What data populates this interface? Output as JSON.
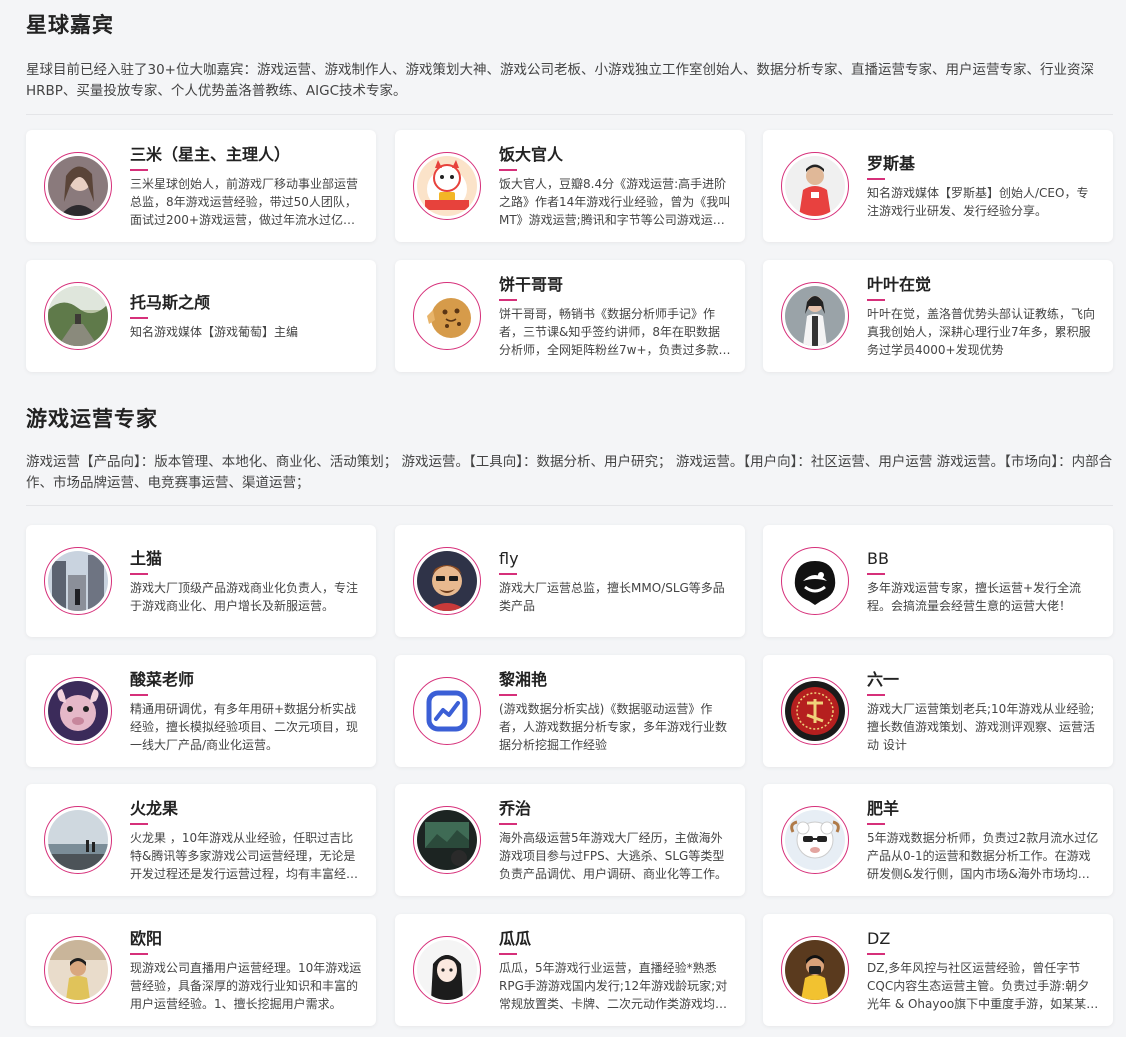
{
  "guests_section": {
    "title": "星球嘉宾",
    "description": "星球目前已经入驻了30+位大咖嘉宾：游戏运营、游戏制作人、游戏策划大神、游戏公司老板、小游戏独立工作室创始人、数据分析专家、直播运营专家、用户运营专家、行业资深HRBP、买量投放专家、个人优势盖洛普教练、AIGC技术专家。",
    "cards": [
      {
        "name": "三米（星主、主理人）",
        "bio": "三米星球创始人，前游戏厂移动事业部运营总监，8年游戏运营经验，带过50人团队，面试过200+游戏运营，做过年流水过亿的游戏项目。",
        "avatar": "portrait-photo"
      },
      {
        "name": "饭大官人",
        "bio": "饭大官人，豆瓣8.4分《游戏运营:高手进阶之路》作者14年游戏行业经验，曾为《我叫 MT》游戏运营;腾讯和字节等公司游戏运营。",
        "avatar": "lucky-cat-icon"
      },
      {
        "name": "罗斯基",
        "bio": "知名游戏媒体【罗斯基】创始人/CEO，专注游戏行业研发、发行经验分享。",
        "avatar": "portrait-photo"
      },
      {
        "name": "托马斯之颅",
        "bio": "知名游戏媒体【游戏葡萄】主编",
        "avatar": "landscape-photo"
      },
      {
        "name": "饼干哥哥",
        "bio": "饼干哥哥，畅销书《数据分析师手记》作者，三节课&知乎签约讲师，8年在职数据分析师，全网矩阵粉丝7w+，负责过多款游戏数据分析。",
        "avatar": "cookie-icon"
      },
      {
        "name": "叶叶在觉",
        "bio": "叶叶在觉，盖洛普优势头部认证教练，飞向真我创始人，深耕心理行业7年多，累积服务过学员4000+发现优势",
        "avatar": "portrait-photo"
      }
    ]
  },
  "experts_section": {
    "title": "游戏运营专家",
    "description": "游戏运营【产品向】：版本管理、本地化、商业化、活动策划； 游戏运营。【工具向】：数据分析、用户研究； 游戏运营。【用户向】：社区运营、用户运营 游戏运营。【市场向】：内部合作、市场品牌运营、电竞赛事运营、渠道运营；",
    "cards": [
      {
        "name": "土猫",
        "bio": "游戏大厂顶级产品游戏商业化负责人，专注于游戏商业化、用户增长及新服运营。",
        "avatar": "city-photo"
      },
      {
        "name": "fly",
        "bio": "游戏大厂运营总监，擅长MMO/SLG等多品类产品",
        "avatar": "cartoon-avatar"
      },
      {
        "name": "BB",
        "bio": "多年游戏运营专家，擅长运营+发行全流程。会搞流量会经营生意的运营大佬！",
        "avatar": "bird-logo-icon"
      },
      {
        "name": "酸菜老师",
        "bio": "精通用研调优，有多年用研+数据分析实战经验，擅长模拟经验项目、二次元项目，现一线大厂产品/商业化运营。",
        "avatar": "creature-photo"
      },
      {
        "name": "黎湘艳",
        "bio": "(游戏数据分析实战)《数据驱动运营》作者，人游戏数据分析专家，多年游戏行业数据分析挖掘工作经验",
        "avatar": "chart-logo-icon"
      },
      {
        "name": "六一",
        "bio": "游戏大厂运营策划老兵;10年游戏从业经验;擅长数值游戏策划、游戏测评观察、运营活动 设计",
        "avatar": "seal-logo-icon"
      },
      {
        "name": "火龙果",
        "bio": "火龙果 ，10年游戏从业经验，任职过吉比特&腾讯等多家游戏公司运营经理，无论是开发过程还是发行运营过程，均有丰富经验。",
        "avatar": "seaside-photo"
      },
      {
        "name": "乔治",
        "bio": "海外高级运营5年游戏大厂经历，主做海外游戏项目参与过FPS、大逃杀、SLG等类型负责产品调优、用户调研、商业化等工作。",
        "avatar": "screen-photo"
      },
      {
        "name": "肥羊",
        "bio": "5年游戏数据分析师，负责过2款月流水过亿产品从0-1的运营和数据分析工作。在游戏研发侧&发行侧，国内市场&海外市场均有经验。",
        "avatar": "sheep-cartoon-icon"
      },
      {
        "name": "欧阳",
        "bio": "现游戏公司直播用户运营经理。10年游戏运营经验，具备深厚的游戏行业知识和丰富的用户运营经验。1、擅长挖掘用户需求。",
        "avatar": "portrait-photo"
      },
      {
        "name": "瓜瓜",
        "bio": "瓜瓜，5年游戏行业运营，直播经验*熟悉RPG手游游戏国内发行;12年游戏龄玩家;对常规放置类、卡牌、二次元动作类游戏均有研究。",
        "avatar": "anime-girl-icon"
      },
      {
        "name": "DZ",
        "bio": "DZ,多年风控与社区运营经验，曾任字节CQC内容生态运营主管。负责过手游:朝夕光年 & Ohayoo旗下中重度手游，如某某某项目。",
        "avatar": "portrait-photo"
      }
    ]
  },
  "colors": {
    "accent": "#d6307a",
    "background": "#f4f5f7",
    "card": "#ffffff"
  }
}
